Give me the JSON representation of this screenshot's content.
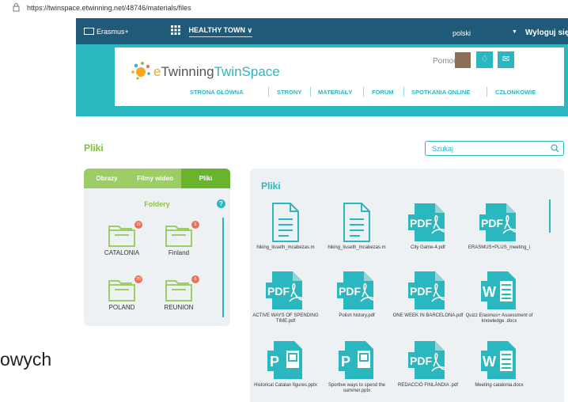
{
  "browser": {
    "url": "https://twinspace.etwinning.net/48746/materials/files"
  },
  "topbar": {
    "erasmus_label": "Erasmus+",
    "project_name": "HEALTHY TOWN",
    "language": "polski",
    "logout": "Wyloguj się"
  },
  "header": {
    "logo_e": "e",
    "logo_twinning": "Twinning",
    "logo_twinspace": "TwinSpace",
    "help": "Pomoc",
    "nav": [
      "STRONA GŁÓWNA",
      "STRONY",
      "MATERIAŁY",
      "FORUM",
      "SPOTKANIA ONLINE",
      "CZŁONKOWIE"
    ]
  },
  "page": {
    "title": "Pliki",
    "search_placeholder": "Szukaj"
  },
  "left_panel": {
    "tabs": [
      "Obrazy",
      "Filmy wideo",
      "Pliki"
    ],
    "active_tab": "Pliki",
    "folders_title": "Foldery",
    "help_glyph": "?",
    "folders": [
      {
        "name": "CATALONIA",
        "count": "15"
      },
      {
        "name": "Finland",
        "count": "6"
      },
      {
        "name": "POLAND",
        "count": "20"
      },
      {
        "name": "REUNION",
        "count": "6"
      }
    ]
  },
  "files_panel": {
    "title": "Pliki",
    "files": [
      {
        "type": "doc",
        "name": "hiking_lisseth_mcabezas.m"
      },
      {
        "type": "doc",
        "name": "hiking_lisseth_mcabezas.m"
      },
      {
        "type": "pdf",
        "name": "City Game-4.pdf"
      },
      {
        "type": "pdf",
        "name": "ERASMUS+PLUS_meeting_i"
      },
      {
        "type": "pdf",
        "name": "ACTIVE WAYS OF SPENDING TIME.pdf"
      },
      {
        "type": "pdf",
        "name": "Polish history.pdf"
      },
      {
        "type": "pdf",
        "name": "ONE WEEK IN BARCELONA.pdf"
      },
      {
        "type": "word",
        "name": "Quizz Erasmus+ Assessment of knowledge .docx"
      },
      {
        "type": "ppt",
        "name": "Historical Catalan figures.pptx"
      },
      {
        "type": "ppt",
        "name": "Sportive ways to spend the summer.pptx"
      },
      {
        "type": "pdf",
        "name": "REDACCIÓ FINLÀNDIA .pdf"
      },
      {
        "type": "word",
        "name": "Meeting catalonia.docx"
      }
    ]
  },
  "overlay_text": "owych",
  "colors": {
    "teal": "#2bb7c0",
    "green": "#7bbf3a",
    "dark_blue": "#1f5a78",
    "badge": "#e8735a"
  }
}
